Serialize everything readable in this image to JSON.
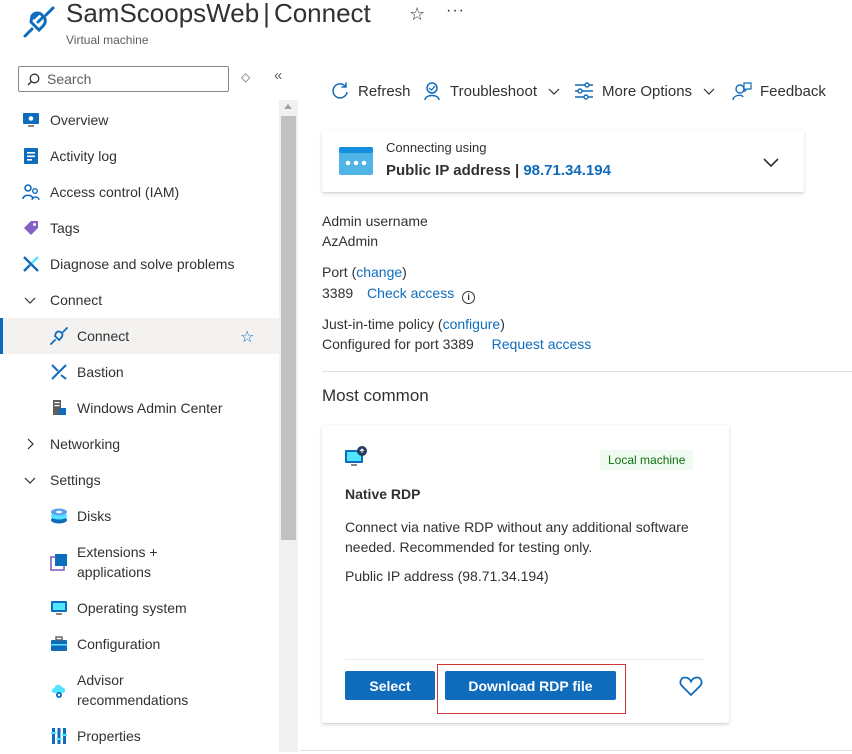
{
  "header": {
    "resource_name": "SamScoopsWeb",
    "separator": "|",
    "page_name": "Connect",
    "subtitle": "Virtual machine",
    "favorite_glyph": "☆",
    "more_glyph": "···"
  },
  "sidebar": {
    "search_placeholder": "Search",
    "items": [
      {
        "label": "Overview",
        "icon": "monitor-icon"
      },
      {
        "label": "Activity log",
        "icon": "activity-log-icon"
      },
      {
        "label": "Access control (IAM)",
        "icon": "people-icon"
      },
      {
        "label": "Tags",
        "icon": "tag-icon"
      },
      {
        "label": "Diagnose and solve problems",
        "icon": "wrench-icon"
      },
      {
        "label": "Connect",
        "icon": "chevron-down-icon",
        "group": true,
        "expanded": true
      },
      {
        "label": "Connect",
        "icon": "plug-icon",
        "active": true,
        "favorite": "☆"
      },
      {
        "label": "Bastion",
        "icon": "bastion-icon"
      },
      {
        "label": "Windows Admin Center",
        "icon": "admin-center-icon"
      },
      {
        "label": "Networking",
        "icon": "chevron-right-icon",
        "group": true,
        "expanded": false
      },
      {
        "label": "Settings",
        "icon": "chevron-down-icon",
        "group": true,
        "expanded": true
      },
      {
        "label": "Disks",
        "icon": "disk-icon"
      },
      {
        "label": "Extensions +",
        "label2": "applications",
        "icon": "extensions-icon"
      },
      {
        "label": "Operating system",
        "icon": "os-icon"
      },
      {
        "label": "Configuration",
        "icon": "configuration-icon"
      },
      {
        "label": "Advisor",
        "label2": "recommendations",
        "icon": "advisor-icon"
      },
      {
        "label": "Properties",
        "icon": "properties-icon"
      }
    ]
  },
  "toolbar": {
    "refresh": "Refresh",
    "troubleshoot": "Troubleshoot",
    "more_options": "More Options",
    "feedback": "Feedback"
  },
  "connection": {
    "caption": "Connecting using",
    "method": "Public IP address",
    "separator": "|",
    "ip": "98.71.34.194"
  },
  "info": {
    "admin_label": "Admin username",
    "admin_value": "AzAdmin",
    "port_label": "Port (",
    "port_link": "change",
    "port_close": ")",
    "port_value": "3389",
    "check_access": "Check access",
    "info_glyph": "i",
    "jit_label": "Just-in-time policy (",
    "jit_link": "configure",
    "jit_close": ")",
    "jit_value": "Configured for port 3389",
    "request_access": "Request access"
  },
  "most_common": {
    "title": "Most common",
    "card": {
      "badge": "Local machine",
      "name": "Native RDP",
      "description": "Connect via native RDP without any additional software needed. Recommended for testing only.",
      "ip_line": "Public IP address (98.71.34.194)",
      "select_button": "Select",
      "download_button": "Download RDP file"
    }
  },
  "colors": {
    "accent": "#0f6cbd",
    "badge_bg": "#f1faf1",
    "badge_text": "#0e700e",
    "highlight": "#d13438"
  }
}
